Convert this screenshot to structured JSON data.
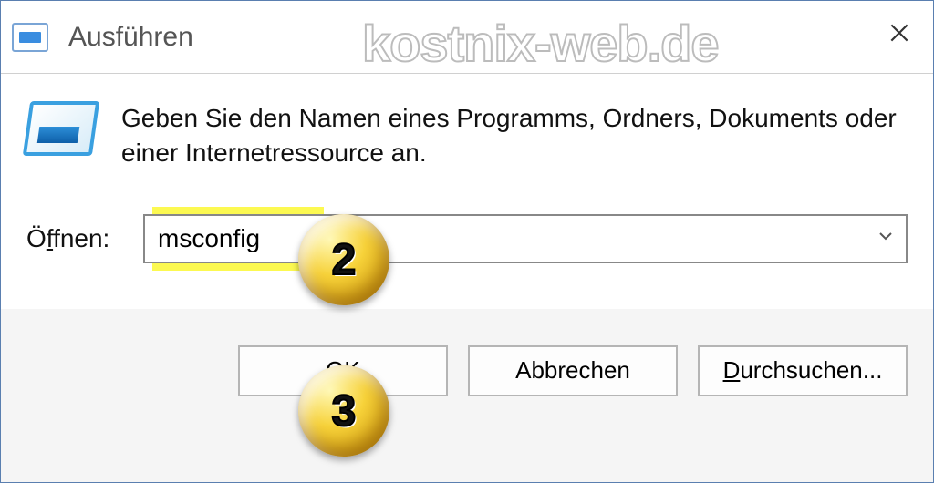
{
  "window": {
    "title": "Ausführen"
  },
  "watermark": "kostnix-web.de",
  "description": "Geben Sie den Namen eines Programms, Ordners, Dokuments oder einer Internetressource an.",
  "open": {
    "label_prefix": "Ö",
    "label_underline": "f",
    "label_suffix": "fnen:",
    "value": "msconfig"
  },
  "buttons": {
    "ok": "OK",
    "cancel": "Abbrechen",
    "browse_underline": "D",
    "browse_rest": "urchsuchen..."
  },
  "annotations": {
    "badge2": "2",
    "badge3": "3"
  },
  "colors": {
    "highlight": "#fcf951",
    "accent": "#3aa0e0"
  }
}
